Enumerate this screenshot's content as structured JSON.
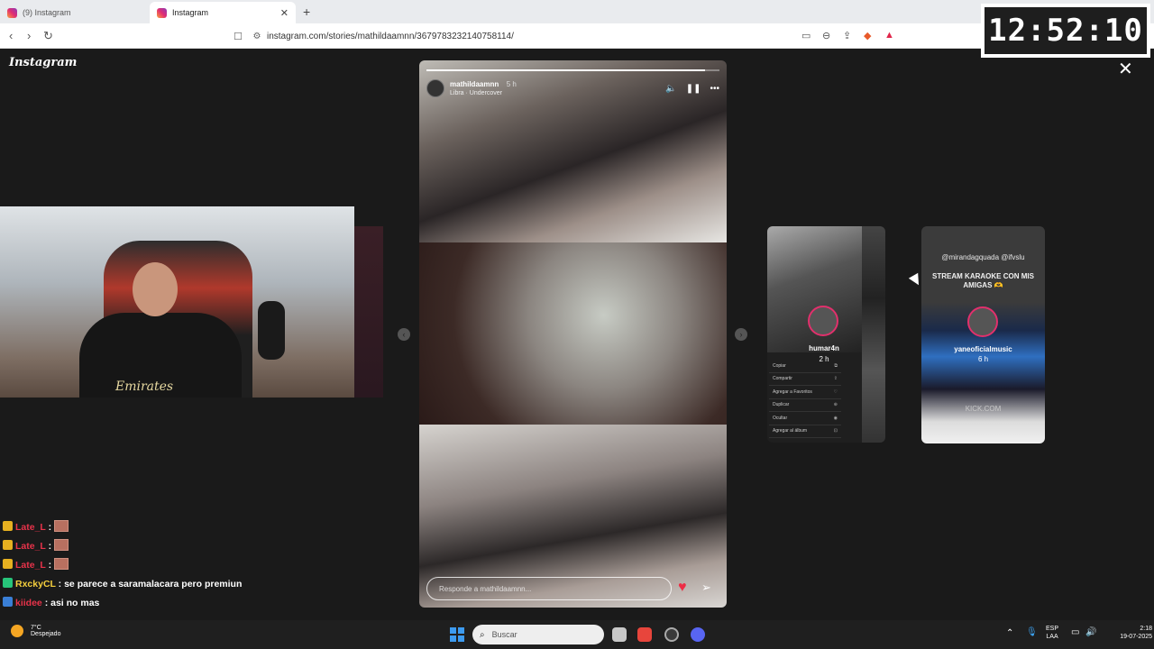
{
  "browser": {
    "tabs": [
      {
        "title": "(9) Instagram",
        "active": false
      },
      {
        "title": "Instagram",
        "active": true
      }
    ],
    "new_tab": "+",
    "url": "instagram.com/stories/mathildaamnn/3679783232140758114/",
    "nav": {
      "back": "‹",
      "forward": "›",
      "reload": "↻"
    }
  },
  "clock": "12:52:10",
  "instagram": {
    "logo": "Instagram",
    "close": "✕",
    "story": {
      "username": "mathildaamnn",
      "time": "5 h",
      "music": "Libra · Undercover",
      "reply_placeholder": "Responde a mathildaamnn...",
      "progress": 0.95
    },
    "side_stories": [
      {
        "name": "humar4n",
        "time": "2 h",
        "menu": [
          "Copiar",
          "Compartir",
          "Agregar a Favoritos",
          "Duplicar",
          "Ocultar",
          "Agregar al álbum"
        ]
      },
      {
        "mentions": "@mirandagquada @ifvslu",
        "text": "STREAM KARAOKE CON MIS AMIGAS 🫶",
        "name": "yaneoficialmusic",
        "time": "6 h",
        "kick": "KICK.COM"
      }
    ]
  },
  "webcam": {
    "shirt_text": "Emirates"
  },
  "chat": [
    {
      "user": "Late_L",
      "msg": "",
      "badge": "yellow",
      "color": "red"
    },
    {
      "user": "Late_L",
      "msg": "",
      "badge": "yellow",
      "color": "red"
    },
    {
      "user": "Late_L",
      "msg": "",
      "badge": "yellow",
      "color": "red"
    },
    {
      "user": "RxckyCL",
      "msg": "se parece a saramalacara pero premiun",
      "badge": "green",
      "color": "yellow"
    },
    {
      "user": "kiidee",
      "msg": "asi no mas",
      "badge": "blue",
      "color": "red"
    }
  ],
  "taskbar": {
    "weather_temp": "7°C",
    "weather_desc": "Despejado",
    "search_placeholder": "Buscar",
    "lang_line1": "ESP",
    "lang_line2": "LAA",
    "time": "2:18",
    "date": "19-07-2025"
  }
}
